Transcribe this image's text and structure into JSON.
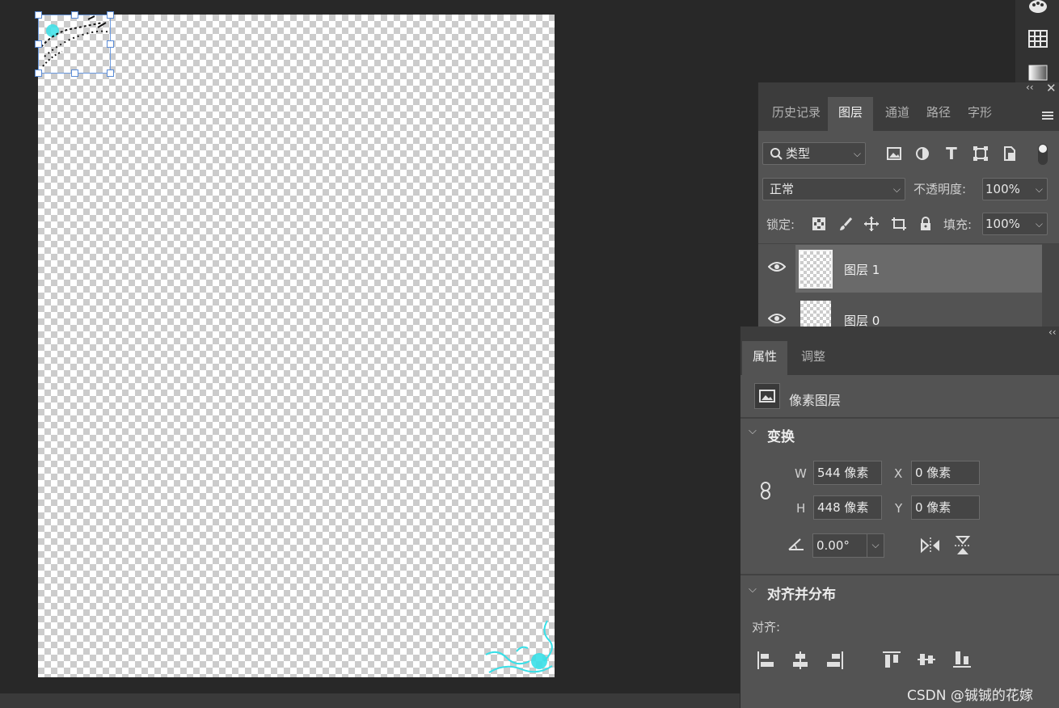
{
  "layers_panel": {
    "tabs": [
      "历史记录",
      "图层",
      "通道",
      "路径",
      "字形"
    ],
    "active_tab": "图层",
    "filter": {
      "label": "类型"
    },
    "blend_mode": "正常",
    "opacity_label": "不透明度:",
    "opacity_value": "100%",
    "lock_label": "锁定:",
    "fill_label": "填充:",
    "fill_value": "100%",
    "layers": [
      {
        "name": "图层 1",
        "selected": true,
        "visible": true
      },
      {
        "name": "图层 0",
        "selected": false,
        "visible": true
      }
    ]
  },
  "properties_panel": {
    "tabs": [
      "属性",
      "调整"
    ],
    "active_tab": "属性",
    "layer_type": "像素图层",
    "transform": {
      "title": "变换",
      "w_label": "W",
      "w_value": "544 像素",
      "h_label": "H",
      "h_value": "448 像素",
      "x_label": "X",
      "x_value": "0 像素",
      "y_label": "Y",
      "y_value": "0 像素",
      "angle_value": "0.00°"
    },
    "align": {
      "title": "对齐并分布",
      "align_label": "对齐:"
    }
  },
  "watermark": "CSDN @铖铖的花嫁",
  "colors": {
    "accent": "#6c9be0",
    "flourish": "#38e0e8",
    "panel_bg": "#535353"
  }
}
